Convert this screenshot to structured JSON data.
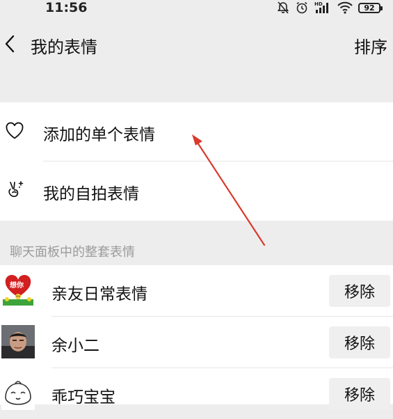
{
  "status": {
    "time": "11:56",
    "battery": "92",
    "network_label": "HD"
  },
  "header": {
    "title": "我的表情",
    "sort_label": "排序"
  },
  "emoji_options": [
    {
      "label": "添加的单个表情",
      "icon": "heart-outline-icon"
    },
    {
      "label": "我的自拍表情",
      "icon": "victory-hand-sparkle-icon"
    }
  ],
  "section_label": "聊天面板中的整套表情",
  "packs": [
    {
      "name": "亲友日常表情",
      "thumb_text": "想你",
      "remove_label": "移除"
    },
    {
      "name": "余小二",
      "remove_label": "移除"
    },
    {
      "name": "乖巧宝宝",
      "remove_label": "移除"
    }
  ],
  "colors": {
    "background": "#ededed",
    "card": "#ffffff",
    "annotation_arrow": "#d93a2b",
    "secondary_text": "#9b9b9b"
  }
}
